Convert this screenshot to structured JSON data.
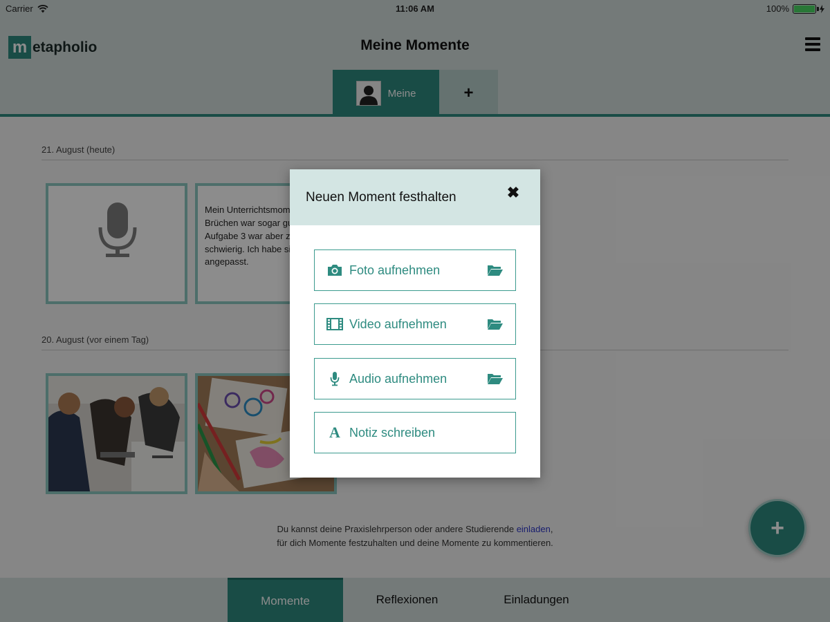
{
  "status_bar": {
    "carrier": "Carrier",
    "time": "11:06 AM",
    "battery": "100%"
  },
  "header": {
    "logo_letter": "m",
    "logo_text": "etapholio",
    "title": "Meine Momente",
    "tabs": [
      {
        "label": "Meine",
        "active": true
      },
      {
        "label": "+",
        "active": false
      }
    ]
  },
  "main": {
    "days": [
      {
        "label": "21. August (heute)",
        "cards": [
          {
            "type": "audio",
            "icon": "microphone-icon"
          },
          {
            "type": "note",
            "text": "Mein Unterrichtsmoment zu Brüchen war sogar gut. Die Aufgabe 3 war aber zu schwierig. Ich habe sie bereits angepasst."
          }
        ]
      },
      {
        "label": "20. August (vor einem Tag)",
        "cards": [
          {
            "type": "photo",
            "subject": "students working on floor"
          },
          {
            "type": "photo",
            "subject": "children drawing with markers"
          }
        ]
      }
    ],
    "invite_line1_before": "Du kannst deine Praxislehrperson oder andere Studierende ",
    "invite_link": "einladen",
    "invite_line1_after": ",",
    "invite_line2": "für dich Momente festzuhalten und deine Momente zu kommentieren.",
    "fab_label": "+"
  },
  "bottom_nav": [
    {
      "label": "Momente",
      "active": true
    },
    {
      "label": "Reflexionen",
      "active": false
    },
    {
      "label": "Einladungen",
      "active": false
    }
  ],
  "modal": {
    "title": "Neuen Moment festhalten",
    "close_icon": "close-icon",
    "options": [
      {
        "label": "Foto aufnehmen",
        "icon": "camera-icon",
        "has_folder": true
      },
      {
        "label": "Video aufnehmen",
        "icon": "film-icon",
        "has_folder": true
      },
      {
        "label": "Audio aufnehmen",
        "icon": "microphone-icon",
        "has_folder": true
      },
      {
        "label": "Notiz schreiben",
        "icon": "text-icon",
        "has_folder": false
      }
    ]
  },
  "colors": {
    "accent": "#2e8b80",
    "header_bg": "#d3dedd",
    "card_border": "#8cc8c1",
    "link": "#2d36c8"
  }
}
